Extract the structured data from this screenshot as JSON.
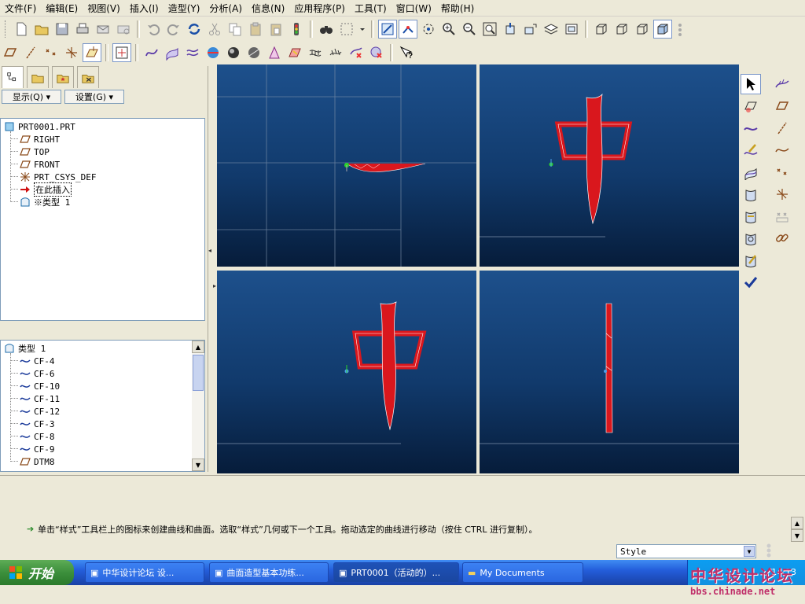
{
  "menu": [
    "文件(F)",
    "编辑(E)",
    "视图(V)",
    "插入(I)",
    "造型(Y)",
    "分析(A)",
    "信息(N)",
    "应用程序(P)",
    "工具(T)",
    "窗口(W)",
    "帮助(H)"
  ],
  "panel": {
    "show_button": "显示(Q) ▾",
    "settings_button": "设置(G) ▾"
  },
  "model_tree": [
    {
      "label": "PRT0001.PRT",
      "icon": "part-icon"
    },
    {
      "label": "RIGHT",
      "icon": "datum-plane-icon"
    },
    {
      "label": "TOP",
      "icon": "datum-plane-icon"
    },
    {
      "label": "FRONT",
      "icon": "datum-plane-icon"
    },
    {
      "label": "PRT_CSYS_DEF",
      "icon": "csys-icon"
    },
    {
      "label": "在此插入",
      "icon": "insert-arrow-icon"
    },
    {
      "label": "※类型 1",
      "icon": "style-feature-icon"
    }
  ],
  "style_tree": [
    {
      "label": "类型 1",
      "icon": "style-feature-icon"
    },
    {
      "label": "CF-4",
      "icon": "curve-icon"
    },
    {
      "label": "CF-6",
      "icon": "curve-icon"
    },
    {
      "label": "CF-10",
      "icon": "curve-icon"
    },
    {
      "label": "CF-11",
      "icon": "curve-icon"
    },
    {
      "label": "CF-12",
      "icon": "curve-icon"
    },
    {
      "label": "CF-3",
      "icon": "curve-icon"
    },
    {
      "label": "CF-8",
      "icon": "curve-icon"
    },
    {
      "label": "CF-9",
      "icon": "curve-icon"
    },
    {
      "label": "DTM8",
      "icon": "datum-plane-icon"
    }
  ],
  "message": "单击“样式”工具栏上的图标来创建曲线和曲面。选取“样式”几何或下一个工具。拖动选定的曲线进行移动（按住 CTRL 进行复制）。",
  "filter_value": "Style",
  "taskbar": {
    "start": "开始",
    "tasks": [
      "中华设计论坛 设...",
      "曲面造型基本功练...",
      "PRT0001（活动的）...",
      "My Documents"
    ],
    "clock": "14:13"
  },
  "watermark": {
    "title": "中华设计论坛",
    "url": "bbs.chinade.net"
  },
  "colors": {
    "viewport_top": "#1d508c",
    "viewport_bottom": "#061c3a",
    "model_red": "#d9171d",
    "taskbar_blue": "#245edb"
  }
}
